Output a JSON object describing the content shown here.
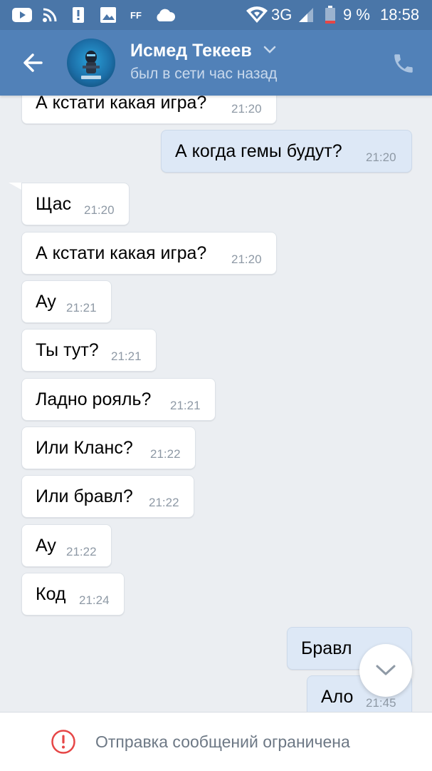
{
  "statusbar": {
    "network": "3G",
    "battery": "9 %",
    "time": "18:58"
  },
  "header": {
    "name": "Исмед Текеев",
    "status": "был в сети час назад"
  },
  "messages": [
    {
      "dir": "in",
      "text": "А кстати какая игра?",
      "time": "21:20"
    },
    {
      "dir": "out",
      "text": "А когда гемы будут?",
      "time": "21:20"
    },
    {
      "dir": "in",
      "text": "Щас",
      "time": "21:20"
    },
    {
      "dir": "in",
      "text": "А кстати какая игра?",
      "time": "21:20"
    },
    {
      "dir": "in",
      "text": "Ау",
      "time": "21:21"
    },
    {
      "dir": "in",
      "text": "Ты тут?",
      "time": "21:21"
    },
    {
      "dir": "in",
      "text": "Ладно рояль?",
      "time": "21:21"
    },
    {
      "dir": "in",
      "text": "Или Кланс?",
      "time": "21:22"
    },
    {
      "dir": "in",
      "text": "Или бравл?",
      "time": "21:22"
    },
    {
      "dir": "in",
      "text": "Ау",
      "time": "21:22"
    },
    {
      "dir": "in",
      "text": "Код",
      "time": "21:24"
    },
    {
      "dir": "out",
      "text": "Бравл",
      "time": ""
    },
    {
      "dir": "out",
      "text": "Ало",
      "time": "21:45"
    }
  ],
  "footer": {
    "restriction": "Отправка сообщений ограничена"
  },
  "colors": {
    "header": "#5181b8",
    "statusbar": "#4a76a8",
    "outgoing": "#dde8f6",
    "incoming": "#ffffff",
    "warning": "#e64646"
  },
  "icons": {
    "back": "arrow-left-icon",
    "call": "phone-icon",
    "scroll": "chevron-down-icon",
    "warning": "exclamation-circle-icon"
  }
}
